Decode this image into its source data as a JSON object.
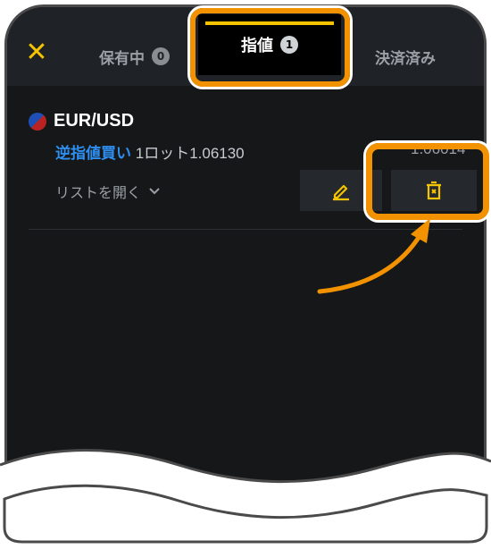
{
  "tabs": {
    "holdings": {
      "label": "保有中",
      "count": "0"
    },
    "orders": {
      "label": "指値",
      "count": "1"
    },
    "settled": {
      "label": "決済済み"
    }
  },
  "order": {
    "pair": "EUR/USD",
    "type": "逆指値買い",
    "detail": "1ロット1.06130",
    "current_price": "1.06014",
    "list_toggle": "リストを開く"
  },
  "colors": {
    "accent": "#f5c400",
    "highlight": "#f39200",
    "buy_blue": "#2f8ff0",
    "background": "#151719"
  },
  "icons": {
    "close": "close-icon",
    "edit": "pencil-icon",
    "delete": "trash-icon",
    "chevron": "chevron-down-icon"
  }
}
